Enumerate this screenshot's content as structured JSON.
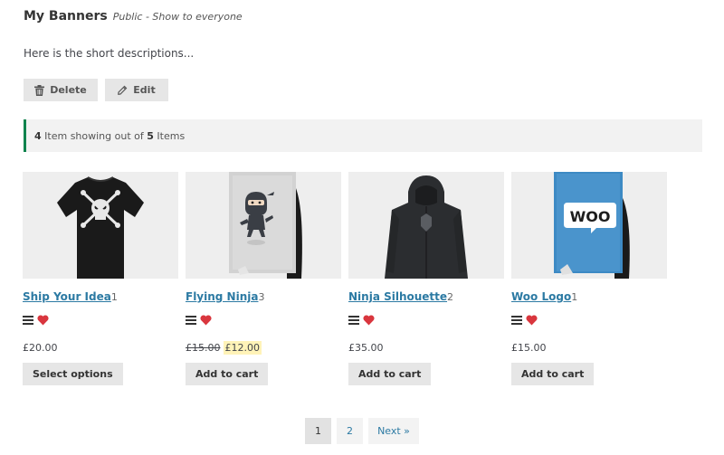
{
  "header": {
    "title": "My Banners",
    "subtitle": "Public - Show to everyone"
  },
  "description": "Here is the short descriptions...",
  "actions": {
    "delete_label": "Delete",
    "edit_label": "Edit"
  },
  "notice": {
    "shown": "4",
    "middle": " Item showing out of ",
    "total": "5",
    "suffix": " Items"
  },
  "products": [
    {
      "name": "Ship Your Idea",
      "count": "1",
      "price": "£20.00",
      "button": "Select options"
    },
    {
      "name": "Flying Ninja",
      "count": "3",
      "old_price": "£15.00",
      "price": "£12.00",
      "button": "Add to cart"
    },
    {
      "name": "Ninja Silhouette",
      "count": "2",
      "price": "£35.00",
      "button": "Add to cart"
    },
    {
      "name": "Woo Logo",
      "count": "1",
      "price": "£15.00",
      "button": "Add to cart",
      "poster_text": "WOO"
    }
  ],
  "pagination": {
    "pages": [
      "1",
      "2"
    ],
    "current": "1",
    "next_label": "Next »"
  },
  "colors": {
    "link": "#2c7aa3",
    "heart": "#d9363e",
    "notice_border": "#0f834d",
    "sale_highlight": "#fff3b8"
  }
}
